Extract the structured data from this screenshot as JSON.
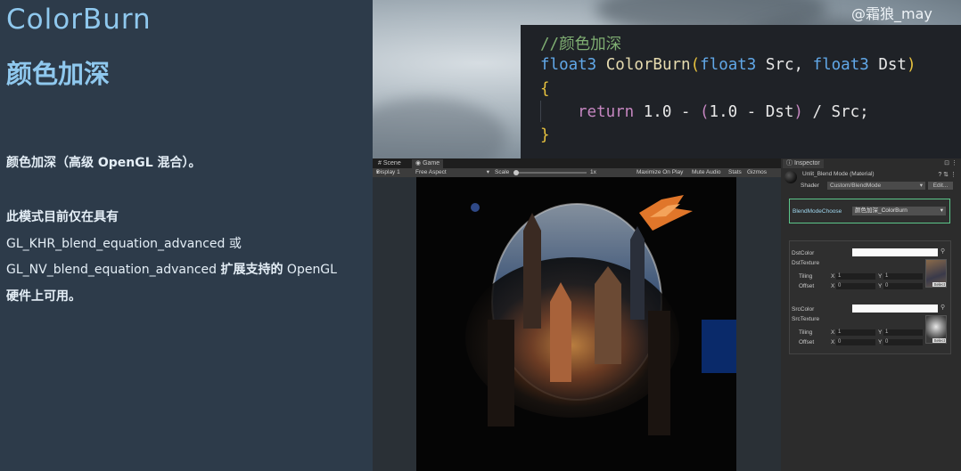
{
  "slide": {
    "title": "ColorBurn",
    "subtitle": "颜色加深",
    "para1": "颜色加深（高级 OpenGL 混合）。",
    "para2_line1": "此模式目前仅在具有",
    "para2_line2": "GL_KHR_blend_equation_advanced 或",
    "para2_line3_a": "GL_NV_blend_equation_advanced ",
    "para2_line3_b": "扩展支持的",
    "para2_line3_c": " OpenGL",
    "para2_line4": "硬件上可用。"
  },
  "watermark": "@霜狼_may",
  "code": {
    "comment": "//颜色加深",
    "type1": "float3",
    "fn": " ColorBurn",
    "paren_open": "(",
    "type2": "float3",
    "arg1": " Src, ",
    "type3": "float3",
    "arg2": " Dst",
    "paren_close": ")",
    "brace_open": "{",
    "ret": "return",
    "expr1": " 1.0 - ",
    "inner_open": "(",
    "expr2": "1.0 - Dst",
    "inner_close": ")",
    "expr3": " / Src;",
    "brace_close": "}"
  },
  "unity": {
    "tabs": [
      "Scene",
      "Game"
    ],
    "game_toolbar": {
      "display": "Display 1",
      "aspect": "Free Aspect",
      "scale_label": "Scale",
      "scale_value": "1x",
      "maximize": "Maximize On Play",
      "mute": "Mute Audio",
      "stats": "Stats",
      "gizmos": "Gizmos"
    }
  },
  "inspector": {
    "tab": "Inspector",
    "material_name": "Unlit_Blend Mode (Material)",
    "shader_label": "Shader",
    "shader_value": "Custom/BlendMode",
    "edit_label": "Edit...",
    "blend_label": "BlendModeChoose",
    "blend_value": "颜色加深_ColorBurn",
    "dst_color_label": "DstColor",
    "dst_texture_label": "DstTexture",
    "src_color_label": "SrcColor",
    "src_texture_label": "SrcTexture",
    "tiling_label": "Tiling",
    "offset_label": "Offset",
    "x_label": "X",
    "y_label": "Y",
    "tiling_x": "1",
    "tiling_y": "1",
    "offset_x": "0",
    "offset_y": "0",
    "select_label": "Select"
  }
}
